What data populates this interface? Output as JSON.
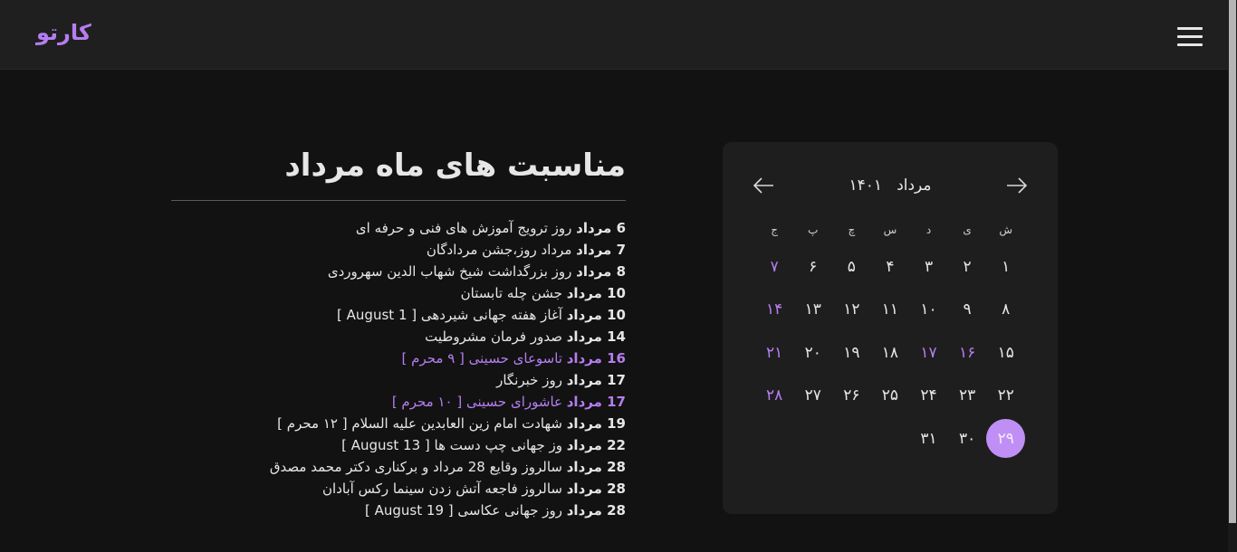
{
  "header": {
    "logo": "کارتو"
  },
  "events": {
    "title": "مناسبت های ماه مرداد",
    "items": [
      {
        "date": "6 مرداد",
        "text": " روز ترویج آموزش های فنی و حرفه ای",
        "holiday": false
      },
      {
        "date": "7 مرداد",
        "text": " مرداد روز،جشن مردادگان",
        "holiday": false
      },
      {
        "date": "8 مرداد",
        "text": " روز بزرگداشت شیخ شهاب الدین سهروردی",
        "holiday": false
      },
      {
        "date": "10 مرداد",
        "text": " جشن چله تابستان",
        "holiday": false
      },
      {
        "date": "10 مرداد",
        "text": " آغاز هفته جهانی شیردهی [ 1 August ]",
        "holiday": false
      },
      {
        "date": "14 مرداد",
        "text": " صدور فرمان مشروطیت",
        "holiday": false
      },
      {
        "date": "16 مرداد",
        "text": " تاسوعای حسینی [ ۹ محرم ]",
        "holiday": true
      },
      {
        "date": "17 مرداد",
        "text": " روز خبرنگار",
        "holiday": false
      },
      {
        "date": "17 مرداد",
        "text": " عاشورای حسینی [ ۱۰ محرم ]",
        "holiday": true
      },
      {
        "date": "19 مرداد",
        "text": " شهادت امام زین العابدین علیه السلام [ ۱۲ محرم ]",
        "holiday": false
      },
      {
        "date": "22 مرداد",
        "text": " وز جهانی چپ دست ها [ 13 August ]",
        "holiday": false
      },
      {
        "date": "28 مرداد",
        "text": " سالروز وقایع 28 مرداد و برکناری دکتر محمد مصدق",
        "holiday": false
      },
      {
        "date": "28 مرداد",
        "text": " سالروز فاجعه آتش زدن سینما رکس آبادان",
        "holiday": false
      },
      {
        "date": "28 مرداد",
        "text": " روز جهانی عکاسی [ 19 August ]",
        "holiday": false
      }
    ]
  },
  "calendar": {
    "month": "مرداد",
    "year": "۱۴۰۱",
    "weekdays": [
      "ش",
      "ی",
      "د",
      "س",
      "چ",
      "پ",
      "ج"
    ],
    "weeks": [
      [
        "۱",
        "۲",
        "۳",
        "۴",
        "۵",
        "۶",
        "۷"
      ],
      [
        "۸",
        "۹",
        "۱۰",
        "۱۱",
        "۱۲",
        "۱۳",
        "۱۴"
      ],
      [
        "۱۵",
        "۱۶",
        "۱۷",
        "۱۸",
        "۱۹",
        "۲۰",
        "۲۱"
      ],
      [
        "۲۲",
        "۲۳",
        "۲۴",
        "۲۵",
        "۲۶",
        "۲۷",
        "۲۸"
      ],
      [
        "۲۹",
        "۳۰",
        "۳۱",
        "",
        "",
        "",
        ""
      ]
    ],
    "holidays": [
      "۱۶",
      "۱۷"
    ],
    "today": "۲۹"
  },
  "colors": {
    "accent": "#b57ef0",
    "background": "#121212",
    "header": "#1f1f1f",
    "card": "#1e1e1e"
  },
  "icons": {
    "menu": "hamburger-icon",
    "prev": "arrow-left-icon",
    "next": "arrow-right-icon"
  }
}
